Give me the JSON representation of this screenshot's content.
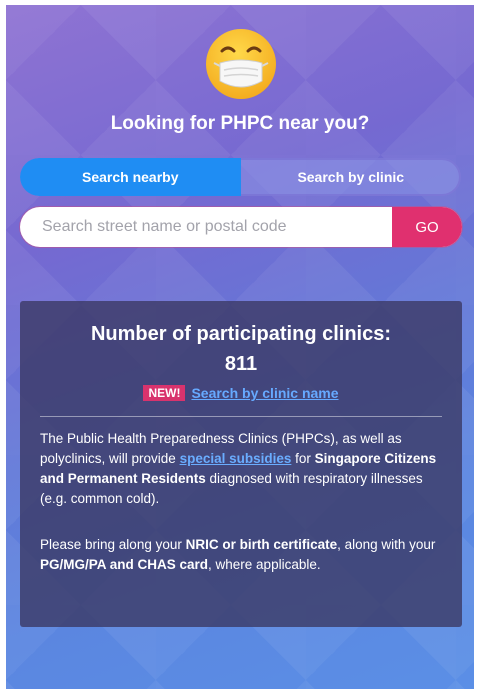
{
  "hero": {
    "icon": "face-with-medical-mask-icon",
    "headline": "Looking for PHPC near you?"
  },
  "tabs": [
    {
      "label": "Search nearby",
      "active": true
    },
    {
      "label": "Search by clinic",
      "active": false
    }
  ],
  "search": {
    "placeholder": "Search street name or postal code",
    "value": "",
    "button_label": "GO"
  },
  "card": {
    "title": "Number of participating clinics:",
    "count": "811",
    "badge": "NEW!",
    "link_text": "Search by clinic name",
    "p1": {
      "t1": "The Public Health Preparedness Clinics (PHPCs), as well as polyclinics, will provide ",
      "link": "special subsidies",
      "t2": " for ",
      "bold1": "Singapore Citizens and Permanent Residents",
      "t3": " diagnosed with respiratory illnesses (e.g. common cold)."
    },
    "p2": {
      "t1": "Please bring along your ",
      "bold1": "NRIC or birth certificate",
      "t2": ", along with your ",
      "bold2": "PG/MG/PA and CHAS card",
      "t3": ", where applicable."
    }
  },
  "colors": {
    "tab_active": "#1f8df3",
    "go_button": "#e0306f",
    "badge": "#d8336d",
    "link": "#66a9ff"
  }
}
